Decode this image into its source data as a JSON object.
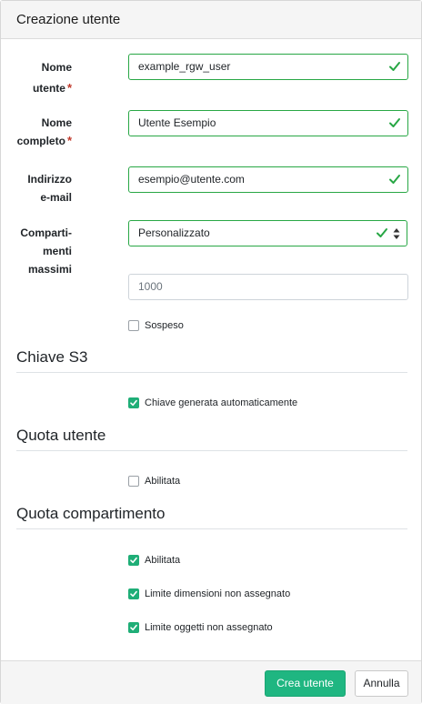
{
  "header": {
    "title": "Creazione utente"
  },
  "form": {
    "username": {
      "label_line1": "Nome",
      "label_line2": "utente",
      "required_mark": "*",
      "value": "example_rgw_user"
    },
    "fullname": {
      "label_line1": "Nome",
      "label_line2": "completo",
      "required_mark": "*",
      "value": "Utente Esempio"
    },
    "email": {
      "label_line1": "Indirizzo",
      "label_line2": "e-mail",
      "value": "esempio@utente.com"
    },
    "max_buckets": {
      "label_line1": "Comparti-",
      "label_line2": "menti",
      "label_line3": "massimi",
      "selected": "Personalizzato",
      "custom_value": "1000"
    },
    "suspended": {
      "label": "Sospeso",
      "checked": false
    }
  },
  "sections": {
    "s3_key": {
      "title": "Chiave S3",
      "auto_generate": {
        "label": "Chiave generata automaticamente",
        "checked": true
      }
    },
    "user_quota": {
      "title": "Quota utente",
      "enabled": {
        "label": "Abilitata",
        "checked": false
      }
    },
    "bucket_quota": {
      "title": "Quota compartimento",
      "enabled": {
        "label": "Abilitata",
        "checked": true
      },
      "unlimited_size": {
        "label": "Limite dimensioni non assegnato",
        "checked": true
      },
      "unlimited_objects": {
        "label": "Limite oggetti non assegnato",
        "checked": true
      }
    }
  },
  "footer": {
    "submit_label": "Crea utente",
    "cancel_label": "Annulla"
  },
  "colors": {
    "valid": "#28a745",
    "primary": "#1fb681",
    "required": "#c0392b"
  },
  "icons": {
    "valid": "check-icon",
    "select": "updown-icon"
  }
}
